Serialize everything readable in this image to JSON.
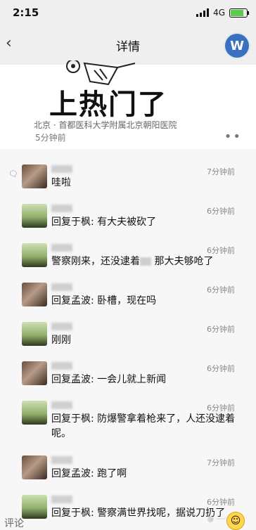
{
  "status": {
    "time": "2:15",
    "network": "4G"
  },
  "nav": {
    "back_icon": "chevron-left-icon",
    "title": "详情",
    "avatar_letter": "W"
  },
  "post": {
    "big_text": "上热门了",
    "location": "北京 · 首都医科大学附属北京朝阳医院",
    "time": "5分钟前",
    "more": "••"
  },
  "comments": [
    {
      "time": "7分钟前",
      "text": "哇啦"
    },
    {
      "time": "6分钟前",
      "text": "回复于枫: 有大夫被砍了"
    },
    {
      "time": "6分钟前",
      "text_before": "警察刚来，还没逮着",
      "text_after": " 那大夫够呛了"
    },
    {
      "time": "6分钟前",
      "text": "回复孟波: 卧槽，现在吗"
    },
    {
      "time": "6分钟前",
      "text": "刚刚"
    },
    {
      "time": "6分钟前",
      "text": "回复孟波: 一会儿就上新闻"
    },
    {
      "time": "6分钟前",
      "text": "回复于枫: 防爆警拿着枪来了，人还没逮着呢。"
    },
    {
      "time": "7分钟前",
      "text": "回复孟波: 跑了啊"
    },
    {
      "time": "6分钟前",
      "text": "回复于枫: 警察满世界找呢，据说刀扔了"
    }
  ],
  "footer": {
    "label": "评论"
  }
}
